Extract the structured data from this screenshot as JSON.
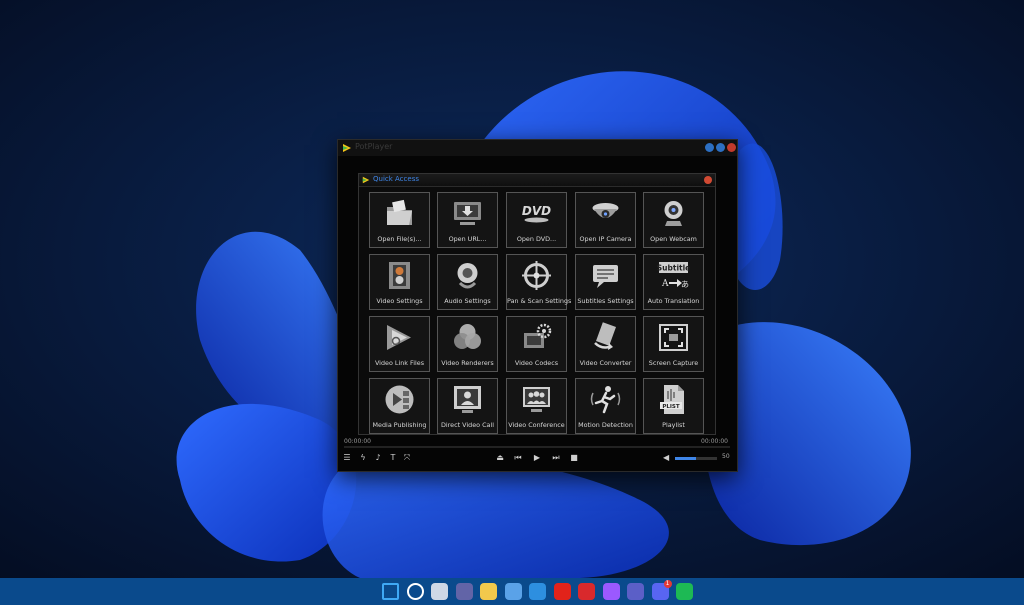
{
  "window": {
    "title": "PotPlayer"
  },
  "quick_access": {
    "title": "Quick Access",
    "tiles": [
      {
        "label": "Open File(s)...",
        "icon": "folder-icon"
      },
      {
        "label": "Open URL...",
        "icon": "download-screen-icon"
      },
      {
        "label": "Open DVD...",
        "icon": "dvd-icon"
      },
      {
        "label": "Open IP Camera",
        "icon": "ip-camera-icon"
      },
      {
        "label": "Open Webcam",
        "icon": "webcam-icon"
      },
      {
        "label": "Video Settings",
        "icon": "film-gear-icon"
      },
      {
        "label": "Audio Settings",
        "icon": "speaker-gear-icon"
      },
      {
        "label": "Pan & Scan Settings",
        "icon": "crosshair-icon"
      },
      {
        "label": "Subtitles Settings",
        "icon": "speech-bubble-icon"
      },
      {
        "label": "Auto Translation",
        "icon": "translate-icon",
        "badge": "Subtitle",
        "from": "A",
        "to": "あ"
      },
      {
        "label": "Video Link Files",
        "icon": "play-triangles-icon"
      },
      {
        "label": "Video Renderers",
        "icon": "rgb-circles-icon"
      },
      {
        "label": "Video Codecs",
        "icon": "film-cog-icon"
      },
      {
        "label": "Video Converter",
        "icon": "film-arrow-icon"
      },
      {
        "label": "Screen Capture",
        "icon": "capture-frame-icon"
      },
      {
        "label": "Media Publishing",
        "icon": "media-publish-icon"
      },
      {
        "label": "Direct Video Call",
        "icon": "video-call-icon"
      },
      {
        "label": "Video Conference",
        "icon": "conference-icon"
      },
      {
        "label": "Motion Detection",
        "icon": "running-man-icon"
      },
      {
        "label": "Playlist",
        "icon": "playlist-file-icon",
        "badge": "PLIST"
      }
    ]
  },
  "playback": {
    "current_time": "00:00:00",
    "total_time": "00:00:00",
    "volume": 50,
    "controls": [
      {
        "name": "menu-button",
        "glyph": "☰"
      },
      {
        "name": "speed-button",
        "glyph": "ϟ"
      },
      {
        "name": "audio-button",
        "glyph": "♪"
      },
      {
        "name": "subtitle-button",
        "glyph": "T"
      },
      {
        "name": "fullscreen-button",
        "glyph": "⤧"
      },
      {
        "name": "open-button",
        "glyph": "⏏"
      },
      {
        "name": "previous-button",
        "glyph": "⏮"
      },
      {
        "name": "play-button",
        "glyph": "▶"
      },
      {
        "name": "next-button",
        "glyph": "⏭"
      },
      {
        "name": "stop-button",
        "glyph": "■"
      }
    ],
    "volume_icon": "speaker-icon"
  },
  "taskbar": {
    "icons": [
      "windows-start-icon",
      "search-icon",
      "task-view-icon",
      "teams-chat-icon",
      "file-explorer-icon",
      "store-icon",
      "mail-icon",
      "opera-icon",
      "wps-office-icon",
      "messenger-icon",
      "teams-icon",
      "discord-icon",
      "spotify-icon"
    ],
    "colors": [
      "#3fa9f5",
      "#ffffff",
      "#cfd8e6",
      "#6264a7",
      "#f2c94c",
      "#5aa2e8",
      "#2d8fe0",
      "#e2231a",
      "#d9292c",
      "#9b59ff",
      "#5b5fc7",
      "#5865f2",
      "#1db954"
    ],
    "discord_badge": "1"
  },
  "colors": {
    "accent": "#3f86e8",
    "close": "#d14a33",
    "window_bg": "#050505"
  }
}
